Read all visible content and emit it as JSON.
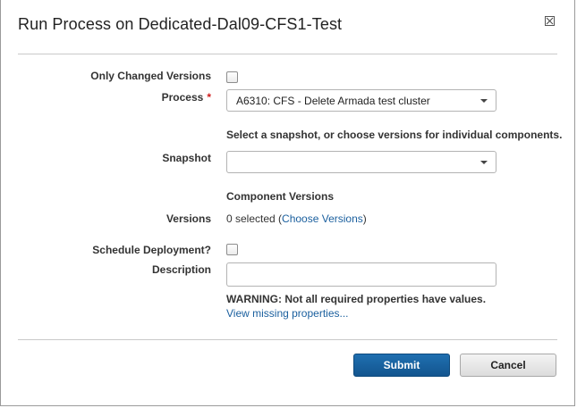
{
  "dialog": {
    "title": "Run Process on Dedicated-Dal09-CFS1-Test"
  },
  "form": {
    "only_changed_label": "Only Changed Versions",
    "process_label": "Process",
    "required_marker": "*",
    "process_value": "A6310: CFS - Delete Armada test cluster",
    "snapshot_hint": "Select a snapshot, or choose versions for individual components.",
    "snapshot_label": "Snapshot",
    "snapshot_value": "",
    "component_versions_heading": "Component Versions",
    "versions_label": "Versions",
    "versions_selected": "0 selected (",
    "choose_versions_link": "Choose Versions",
    "versions_close_paren": ")",
    "schedule_label": "Schedule Deployment?",
    "description_label": "Description",
    "description_value": "",
    "warning_text": "WARNING: Not all required properties have values.",
    "view_missing_link": "View missing properties..."
  },
  "buttons": {
    "submit": "Submit",
    "cancel": "Cancel"
  }
}
